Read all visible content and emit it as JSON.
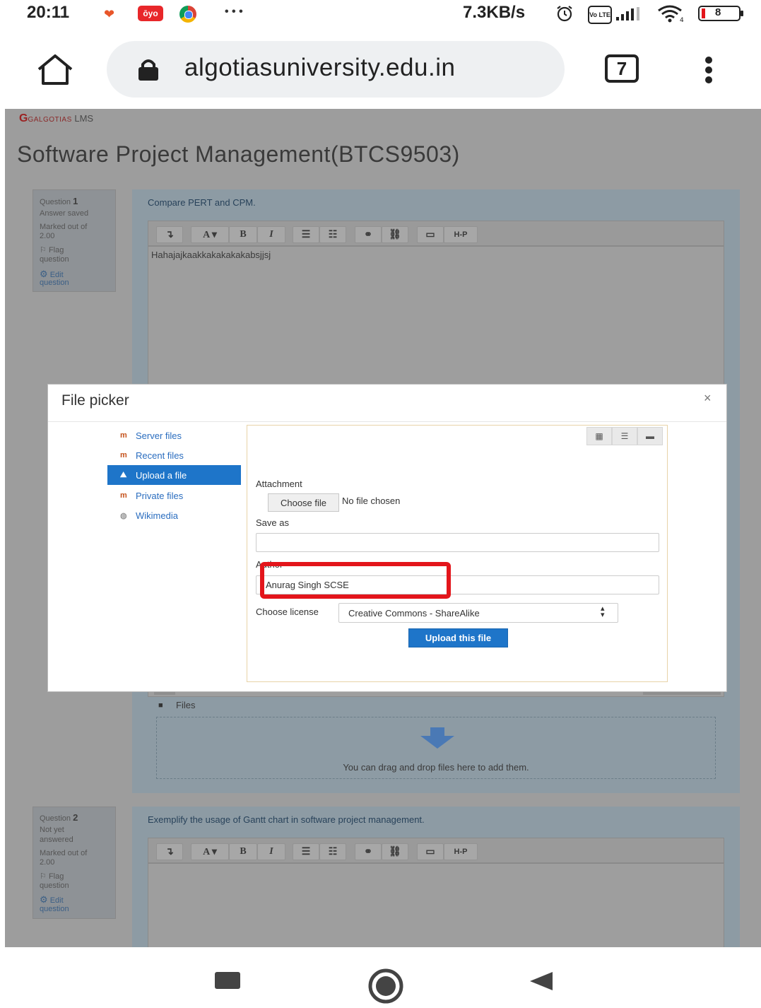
{
  "status_bar": {
    "time": "20:11",
    "app_icons": [
      "heart-icon",
      "oyo-icon",
      "chrome-icon"
    ],
    "oyo_label": "ōyo",
    "more_dots": "• • •",
    "net_speed": "7.3KB/s",
    "volte_label": "Vo LTE",
    "battery": "8"
  },
  "browser": {
    "url": "algotiasuniversity.edu.in",
    "tab_count": "7"
  },
  "site": {
    "logo_g": "G",
    "logo_text": "GALGOTIAS",
    "logo_suffix": "LMS",
    "course_title": "Software Project Management(BTCS9503)"
  },
  "questions": [
    {
      "label": "Question",
      "number": "1",
      "state": "Answer saved",
      "marked_line1": "Marked out of",
      "marked_line2": "2.00",
      "flag_line1": "Flag",
      "flag_line2": "question",
      "edit_line1": "Edit",
      "edit_line2": "question",
      "prompt": "Compare PERT and CPM.",
      "answer": "Hahajajkaakkakakakakabsjjsj"
    },
    {
      "label": "Question",
      "number": "2",
      "state_line1": "Not yet",
      "state_line2": "answered",
      "marked_line1": "Marked out of",
      "marked_line2": "2.00",
      "flag_line1": "Flag",
      "flag_line2": "question",
      "edit_line1": "Edit",
      "edit_line2": "question",
      "prompt": "Exemplify the usage of Gantt chart in software project management.",
      "answer": ""
    }
  ],
  "editor_toolbar": {
    "font_label": "A ▾",
    "bold": "B",
    "italic": "I",
    "h5p": "H-P"
  },
  "filemanager": {
    "files_label": "Files",
    "dnd_text": "You can drag and drop files here to add them."
  },
  "file_picker": {
    "title": "File picker",
    "close": "×",
    "repositories": [
      {
        "label": "Server files",
        "icon": "moodle-icon"
      },
      {
        "label": "Recent files",
        "icon": "moodle-icon"
      },
      {
        "label": "Upload a file",
        "icon": "upload-icon",
        "active": true
      },
      {
        "label": "Private files",
        "icon": "moodle-icon"
      },
      {
        "label": "Wikimedia",
        "icon": "wikimedia-icon"
      }
    ],
    "attachment_label": "Attachment",
    "choose_file": "Choose file",
    "no_file": "No file chosen",
    "save_as_label": "Save as",
    "save_as_value": "",
    "author_label": "Author",
    "author_value": "Anurag Singh SCSE",
    "license_label": "Choose license",
    "license_value": "Creative Commons - ShareAlike",
    "upload_button": "Upload this file"
  },
  "colors": {
    "accent": "#1e75c9",
    "highlight_box": "#e3151b",
    "link": "#2a6dbf"
  }
}
